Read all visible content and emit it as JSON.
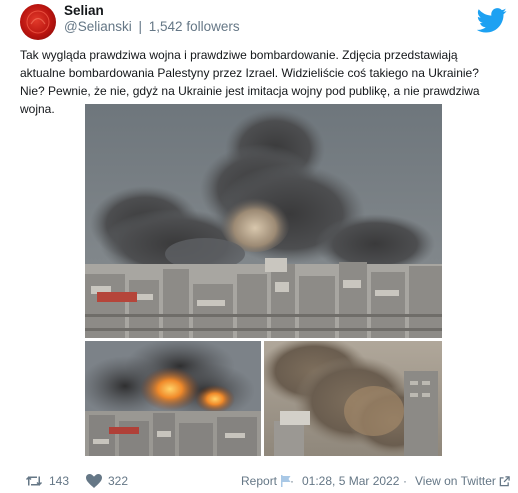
{
  "author": {
    "name": "Selian",
    "handle": "@Selianski",
    "separator": "|",
    "followers": "1,542 followers"
  },
  "tweet": {
    "text": "Tak wygląda prawdziwa wojna i prawdziwe bombardowanie. Zdjęcia przedstawiają aktualne bombardowania Palestyny przez Izrael. Widzieliście coś takiego na Ukrainie? Nie? Pewnie, że nie, gdyż na Ukrainie jest imitacja wojny pod publikę, a nie prawdziwa wojna."
  },
  "footer": {
    "retweets": "143",
    "likes": "322",
    "report_label": "Report",
    "separator": "·",
    "timestamp": "01:28, 5 Mar 2022",
    "view_on_label": "View on Twitter"
  },
  "icons": {
    "brand": "twitter-bird-icon",
    "retweet": "retweet-icon",
    "like": "heart-icon",
    "report": "flag-icon",
    "external": "external-link-icon"
  },
  "colors": {
    "brand_blue": "#1da1f2",
    "muted_text": "#657786",
    "avatar_red": "#c4170f"
  }
}
